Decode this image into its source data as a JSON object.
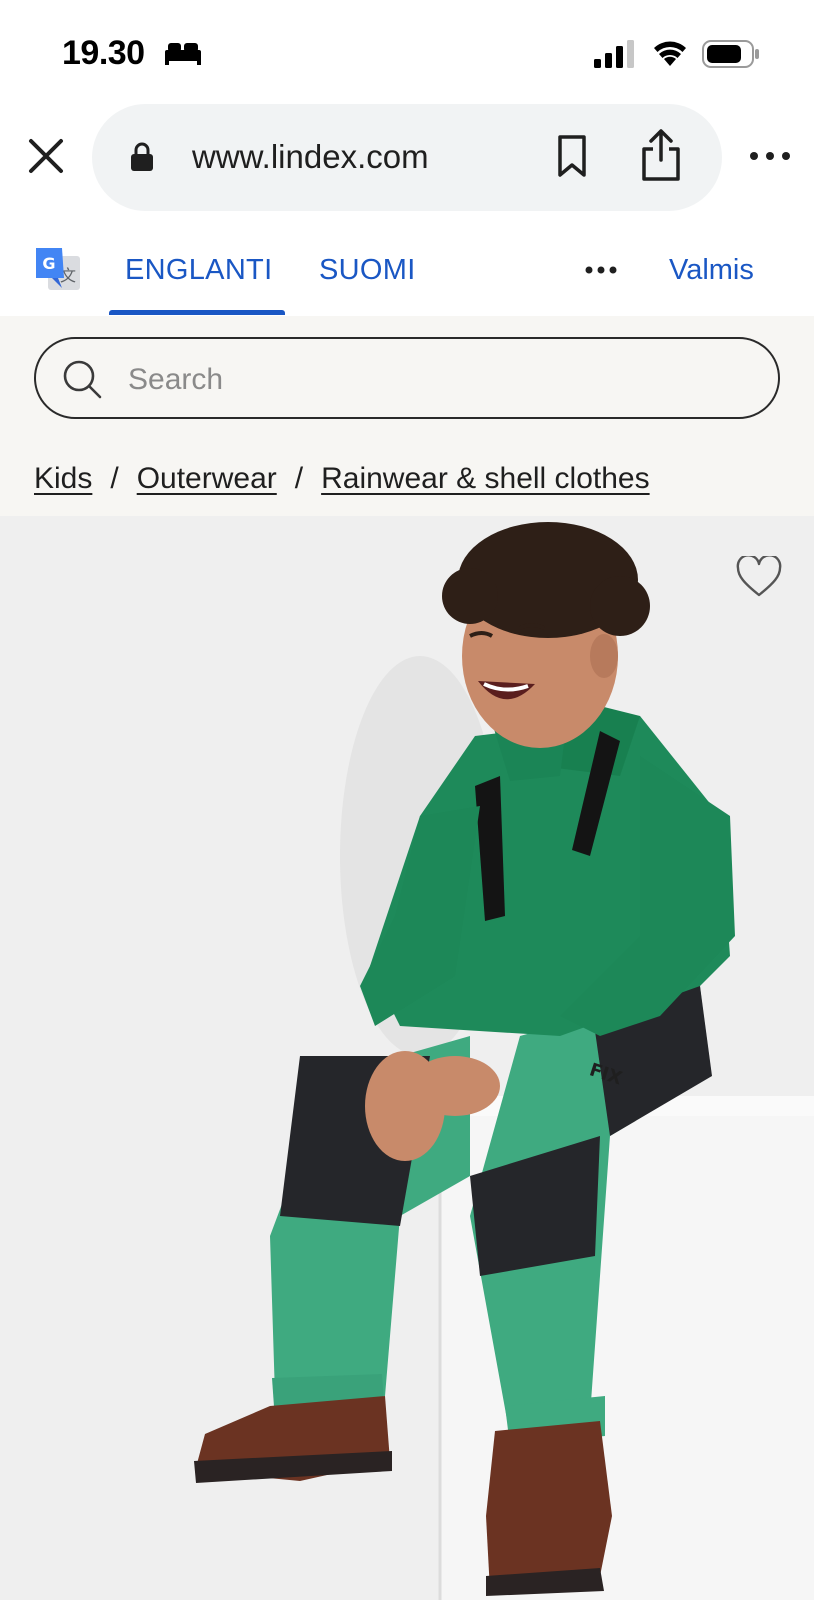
{
  "status_bar": {
    "time": "19.30",
    "icons": [
      "bed-icon",
      "signal-icon",
      "wifi-icon",
      "battery-icon"
    ]
  },
  "browser": {
    "url": "www.lindex.com",
    "icons": [
      "close-icon",
      "lock-icon",
      "bookmark-icon",
      "share-icon",
      "more-icon"
    ]
  },
  "translate_bar": {
    "tabs": [
      {
        "label": "ENGLANTI",
        "active": true
      },
      {
        "label": "SUOMI",
        "active": false
      }
    ],
    "done_label": "Valmis",
    "accent_color": "#1a57c4",
    "icons": [
      "google-translate-icon",
      "more-icon"
    ]
  },
  "site": {
    "search": {
      "placeholder": "Search"
    },
    "breadcrumb": [
      {
        "label": "Kids"
      },
      {
        "label": "Outerwear"
      },
      {
        "label": "Rainwear & shell clothes"
      }
    ],
    "separator": "/",
    "header_background": "#f7f6f3"
  },
  "product": {
    "image": "child-in-green-fleece-and-rain-trousers-photo",
    "trouser_logo": "FIX",
    "favorite_icon": "heart-icon"
  }
}
